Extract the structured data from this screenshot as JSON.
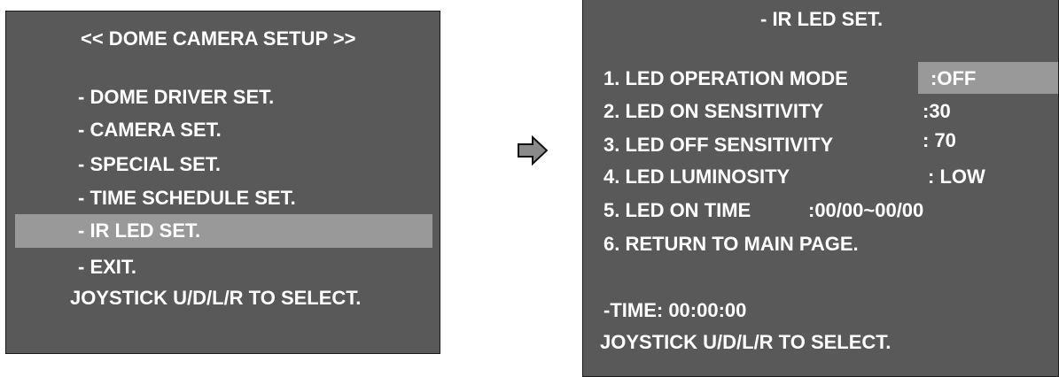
{
  "main_menu": {
    "title": "<< DOME CAMERA SETUP >>",
    "items": [
      {
        "label": "- DOME DRIVER SET."
      },
      {
        "label": "- CAMERA SET."
      },
      {
        "label": "- SPECIAL SET."
      },
      {
        "label": "- TIME SCHEDULE SET."
      },
      {
        "label": "- IR LED SET.",
        "selected": true
      },
      {
        "label": "- EXIT."
      }
    ],
    "hint": "JOYSTICK U/D/L/R TO SELECT."
  },
  "arrow_icon": "right-arrow-icon",
  "ir_menu": {
    "title": "- IR LED SET.",
    "items": [
      {
        "label": "1. LED OPERATION MODE",
        "value": ":OFF",
        "selected": true
      },
      {
        "label": "2. LED ON SENSITIVITY",
        "value": ":30"
      },
      {
        "label": "3. LED OFF SENSITIVITY",
        "value": ": 70"
      },
      {
        "label": "4. LED LUMINOSITY",
        "value": ": LOW"
      },
      {
        "label": "5. LED ON TIME",
        "value": ":00/00~00/00"
      },
      {
        "label": "6. RETURN TO MAIN PAGE."
      }
    ],
    "time": "-TIME: 00:00:00",
    "hint": "JOYSTICK U/D/L/R TO SELECT."
  },
  "colors": {
    "osd_background": "#595959",
    "highlight": "#999999",
    "text": "#ffffff"
  }
}
